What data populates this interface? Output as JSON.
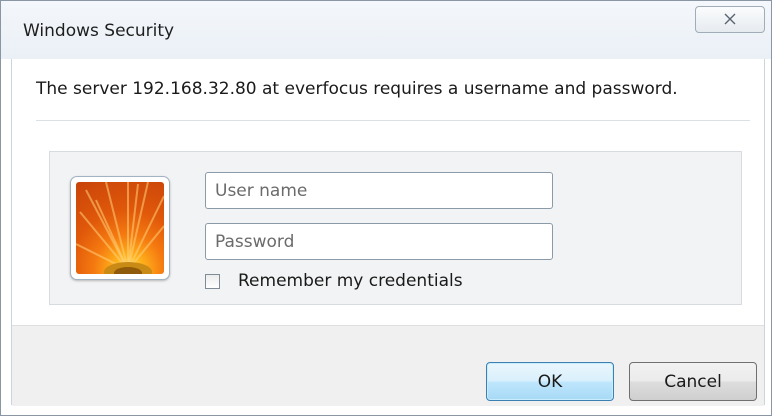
{
  "window": {
    "title": "Windows Security",
    "close_icon": "close-icon"
  },
  "dialog": {
    "message": "The server 192.168.32.80 at everfocus requires a username and password."
  },
  "credentials": {
    "tile_icon": "user-tile-flower-icon",
    "username_placeholder": "User name",
    "username_value": "",
    "password_placeholder": "Password",
    "password_value": "",
    "remember_label": "Remember my credentials",
    "remember_checked": false
  },
  "buttons": {
    "ok_label": "OK",
    "cancel_label": "Cancel"
  },
  "colors": {
    "ok_button_border": "#3c7fb1",
    "ok_button_fill": "#bee6fd",
    "tile_orange": "#f57a10"
  }
}
